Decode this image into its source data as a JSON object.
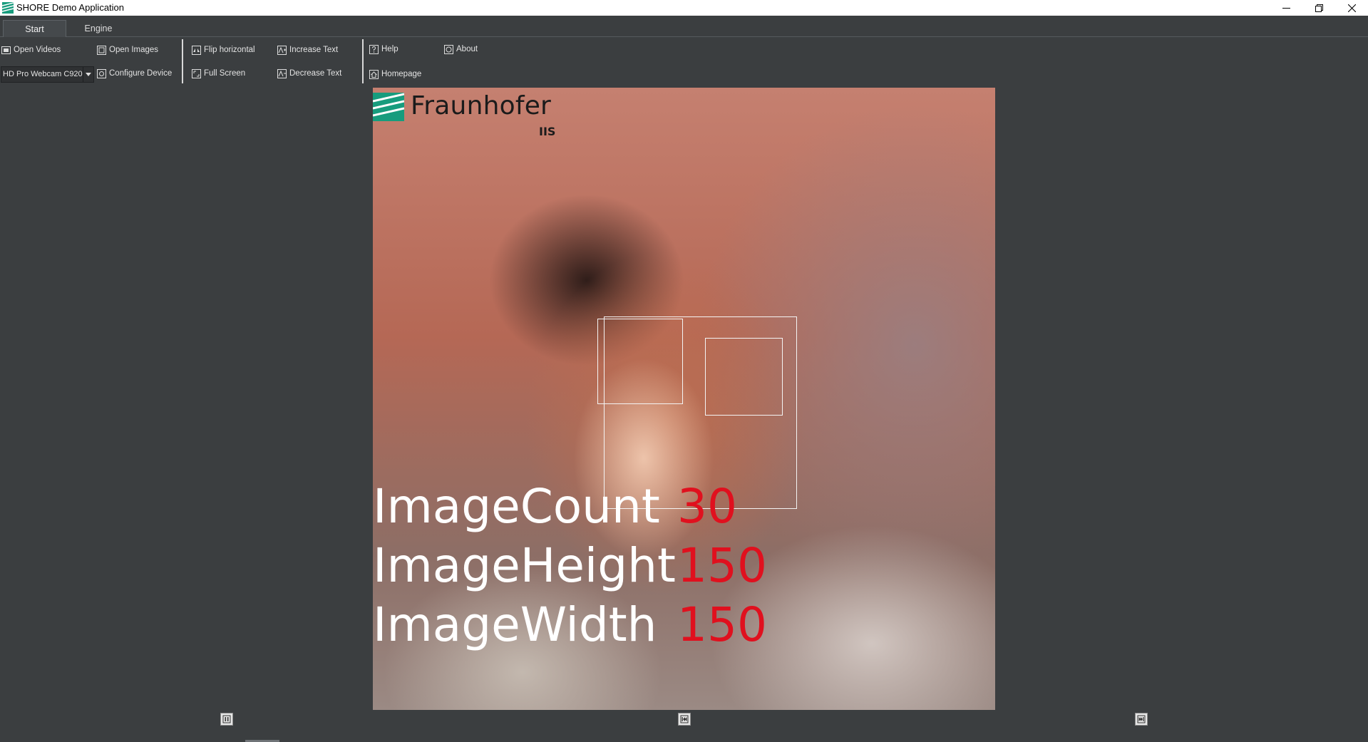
{
  "window": {
    "title": "SHORE Demo Application",
    "app_icon": "fraunhofer-logo-icon",
    "controls": [
      "minimize-icon",
      "restore-icon",
      "close-icon"
    ]
  },
  "tabs": [
    {
      "label": "Start",
      "active": true
    },
    {
      "label": "Engine",
      "active": false
    }
  ],
  "toolbar": {
    "open_videos": {
      "label": "Open Videos",
      "icon": "film-icon"
    },
    "open_images": {
      "label": "Open Images",
      "icon": "image-icon"
    },
    "device_select": {
      "value": "HD Pro Webcam C920"
    },
    "configure_device": {
      "label": "Configure Device",
      "icon": "camera-config-icon"
    },
    "flip_horizontal": {
      "label": "Flip horizontal",
      "icon": "flip-icon"
    },
    "full_screen": {
      "label": "Full Screen",
      "icon": "fullscreen-icon"
    },
    "increase_text": {
      "label": "Increase Text",
      "icon": "text-increase-icon"
    },
    "decrease_text": {
      "label": "Decrease Text",
      "icon": "text-decrease-icon"
    },
    "help": {
      "label": "Help",
      "icon": "question-icon"
    },
    "homepage": {
      "label": "Homepage",
      "icon": "home-icon"
    },
    "about": {
      "label": "About",
      "icon": "info-icon"
    }
  },
  "viewer": {
    "logo": {
      "name": "Fraunhofer",
      "subtitle": "IIS"
    },
    "stats": [
      {
        "key": "ImageCount",
        "value": "30"
      },
      {
        "key": "ImageHeight",
        "value": "150"
      },
      {
        "key": "ImageWidth",
        "value": "150"
      }
    ],
    "overlay_colors": {
      "key": "#ffffff",
      "value": "#e0101e",
      "box": "#f4f4f4"
    }
  },
  "player": {
    "buttons": [
      "pause-icon",
      "step-back-icon",
      "step-forward-icon"
    ]
  }
}
